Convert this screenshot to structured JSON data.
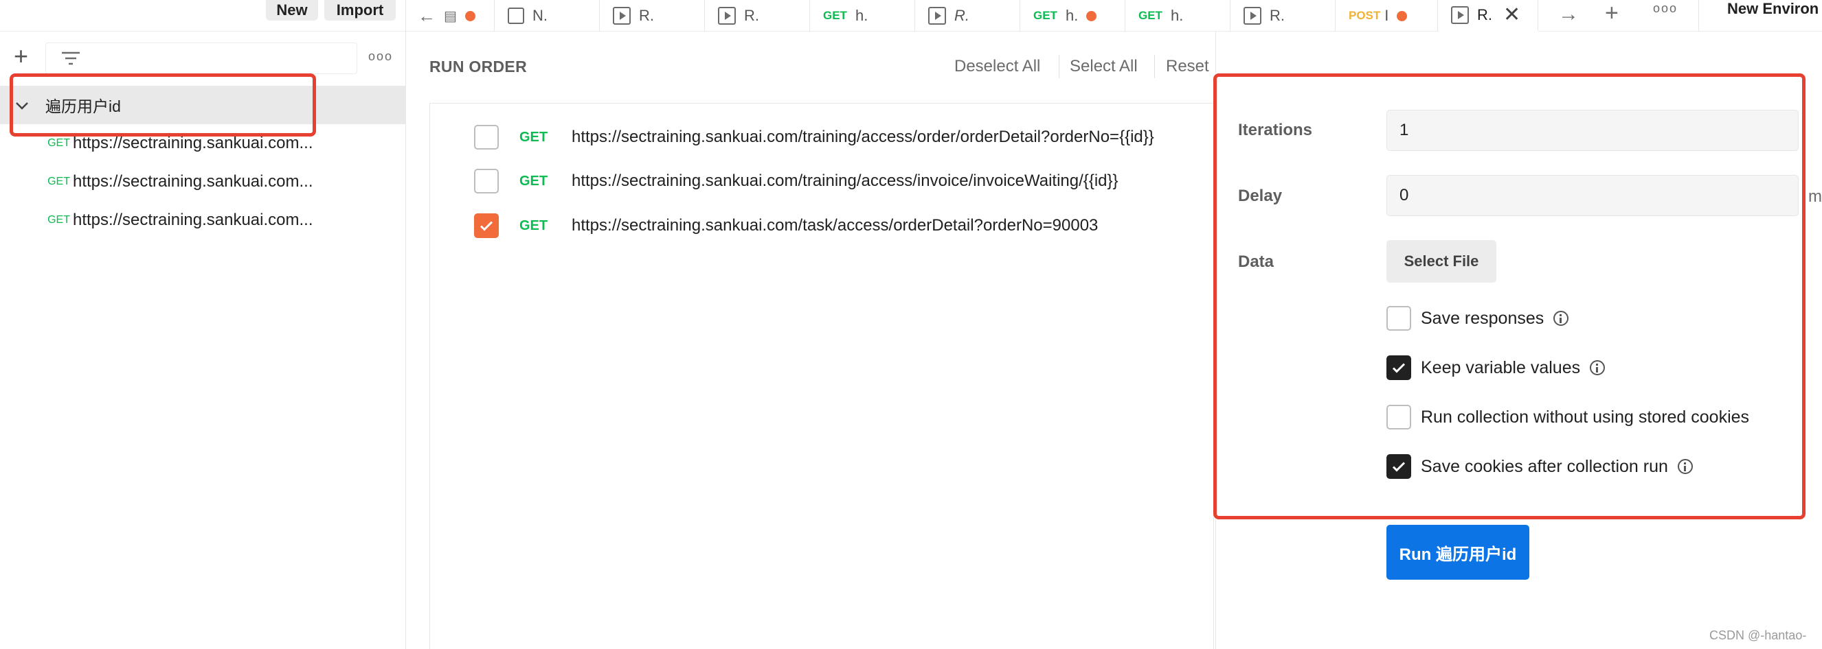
{
  "header": {
    "new_label": "New",
    "import_label": "Import",
    "new_environment_label": "New Environ",
    "tabs": [
      {
        "label": "N."
      },
      {
        "label": "R."
      },
      {
        "label": "R."
      },
      {
        "method": "GET",
        "label": "h."
      },
      {
        "label": "R."
      },
      {
        "method": "GET",
        "label": "h."
      },
      {
        "method": "GET",
        "label": "h."
      },
      {
        "label": "R."
      },
      {
        "method": "POST",
        "label": "I"
      },
      {
        "label": "R."
      }
    ]
  },
  "sidebar": {
    "collection_name": "遍历用户id",
    "requests": [
      {
        "method": "GET",
        "url": "https://sectraining.sankuai.com..."
      },
      {
        "method": "GET",
        "url": "https://sectraining.sankuai.com..."
      },
      {
        "method": "GET",
        "url": "https://sectraining.sankuai.com..."
      }
    ]
  },
  "run_order": {
    "title": "RUN ORDER",
    "deselect_all": "Deselect All",
    "select_all": "Select All",
    "reset": "Reset",
    "requests": [
      {
        "method": "GET",
        "url": "https://sectraining.sankuai.com/training/access/order/orderDetail?orderNo={{id}}",
        "checked": false
      },
      {
        "method": "GET",
        "url": "https://sectraining.sankuai.com/training/access/invoice/invoiceWaiting/{{id}}",
        "checked": false
      },
      {
        "method": "GET",
        "url": "https://sectraining.sankuai.com/task/access/orderDetail?orderNo=90003",
        "checked": true
      }
    ]
  },
  "config": {
    "iterations_label": "Iterations",
    "iterations_value": "1",
    "delay_label": "Delay",
    "delay_value": "0",
    "delay_unit": "m",
    "data_label": "Data",
    "select_file": "Select File",
    "options": [
      {
        "label": "Save responses",
        "checked": false,
        "info": true
      },
      {
        "label": "Keep variable values",
        "checked": true,
        "info": true
      },
      {
        "label": "Run collection without using stored cookies",
        "checked": false,
        "info": false
      },
      {
        "label": "Save cookies after collection run",
        "checked": true,
        "info": true
      }
    ],
    "run_button": "Run 遍历用户id"
  },
  "watermark": "CSDN @-hantao-",
  "colors": {
    "accent_orange": "#f26b3a",
    "run_blue": "#0c74e4",
    "get_green": "#0cbb52",
    "post_yellow": "#f2b134",
    "highlight_red": "#e84030"
  }
}
